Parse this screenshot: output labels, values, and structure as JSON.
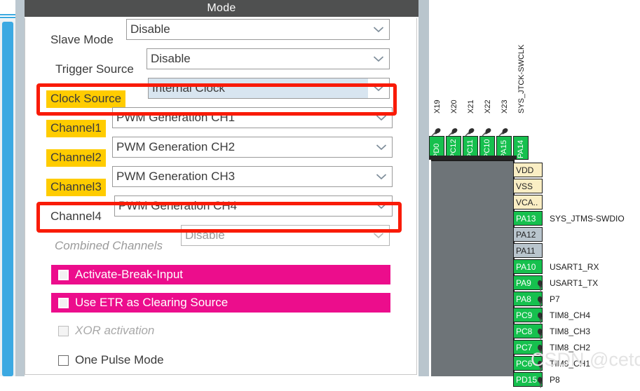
{
  "panel": {
    "title": "Mode",
    "fields": [
      {
        "label": "Slave Mode",
        "value": "Disable",
        "highlight": false,
        "dim": false,
        "selected": false
      },
      {
        "label": "Trigger Source",
        "value": "Disable",
        "highlight": false,
        "dim": false,
        "selected": false
      },
      {
        "label": "Clock Source",
        "value": "Internal Clock",
        "highlight": true,
        "dim": false,
        "selected": true
      },
      {
        "label": "Channel1",
        "value": "PWM Generation CH1",
        "highlight": true,
        "dim": false,
        "selected": false
      },
      {
        "label": "Channel2",
        "value": "PWM Generation CH2",
        "highlight": true,
        "dim": false,
        "selected": false
      },
      {
        "label": "Channel3",
        "value": "PWM Generation CH3",
        "highlight": true,
        "dim": false,
        "selected": false
      },
      {
        "label": "Channel4",
        "value": "PWM Generation CH4",
        "highlight": false,
        "dim": false,
        "selected": false
      },
      {
        "label": "Combined Channels",
        "value": "Disable",
        "highlight": false,
        "dim": true,
        "selected": false
      }
    ],
    "checkboxes": [
      {
        "label": "Activate-Break-Input",
        "style": "pink",
        "checked": false
      },
      {
        "label": "Use ETR as Clearing Source",
        "style": "pink",
        "checked": false
      },
      {
        "label": "XOR activation",
        "style": "disabled",
        "checked": false
      },
      {
        "label": "One Pulse Mode",
        "style": "normal",
        "checked": false
      }
    ]
  },
  "chip": {
    "top_pins": [
      {
        "name": "PD0",
        "label": "X19"
      },
      {
        "name": "PC12",
        "label": "X20"
      },
      {
        "name": "PC11",
        "label": "X21"
      },
      {
        "name": "PC10",
        "label": "X22"
      },
      {
        "name": "PA15",
        "label": "X23"
      },
      {
        "name": "PA14",
        "label": "SYS_JTCK-SWCLK"
      }
    ],
    "right_pins": [
      {
        "name": "VDD",
        "type": "cream",
        "signal": "",
        "pinned": false,
        "highlighted": false
      },
      {
        "name": "VSS",
        "type": "cream",
        "signal": "",
        "pinned": false,
        "highlighted": false
      },
      {
        "name": "VCA..",
        "type": "cream",
        "signal": "",
        "pinned": false,
        "highlighted": false
      },
      {
        "name": "PA13",
        "type": "green",
        "signal": "SYS_JTMS-SWDIO",
        "pinned": false,
        "highlighted": false
      },
      {
        "name": "PA12",
        "type": "gray",
        "signal": "",
        "pinned": false,
        "highlighted": false
      },
      {
        "name": "PA11",
        "type": "gray",
        "signal": "",
        "pinned": false,
        "highlighted": false
      },
      {
        "name": "PA10",
        "type": "green",
        "signal": "USART1_RX",
        "pinned": false,
        "highlighted": false
      },
      {
        "name": "PA9",
        "type": "green",
        "signal": "USART1_TX",
        "pinned": true,
        "highlighted": false
      },
      {
        "name": "PA8",
        "type": "green",
        "signal": "P7",
        "pinned": true,
        "highlighted": false
      },
      {
        "name": "PC9",
        "type": "green",
        "signal": "TIM8_CH4",
        "pinned": true,
        "highlighted": true
      },
      {
        "name": "PC8",
        "type": "green",
        "signal": "TIM8_CH3",
        "pinned": true,
        "highlighted": false
      },
      {
        "name": "PC7",
        "type": "green",
        "signal": "TIM8_CH2",
        "pinned": true,
        "highlighted": false
      },
      {
        "name": "PC6",
        "type": "green",
        "signal": "TIM8_CH1",
        "pinned": true,
        "highlighted": false
      },
      {
        "name": "PD15",
        "type": "green",
        "signal": "P8",
        "pinned": true,
        "highlighted": false
      }
    ]
  },
  "watermark": {
    "text": "CSDN @cetclyb"
  },
  "colors": {
    "highlight_yellow": "#ffcc00",
    "pink": "#ec0d8c",
    "annotation_red": "#fc1803",
    "pin_green": "#16c04e",
    "pin_cream": "#faeec4",
    "pin_gray": "#b9c5cd",
    "header_gray": "#4f5050",
    "selected_blue": "#d8e5f0",
    "scrollbar_blue": "#3ca9e2"
  }
}
